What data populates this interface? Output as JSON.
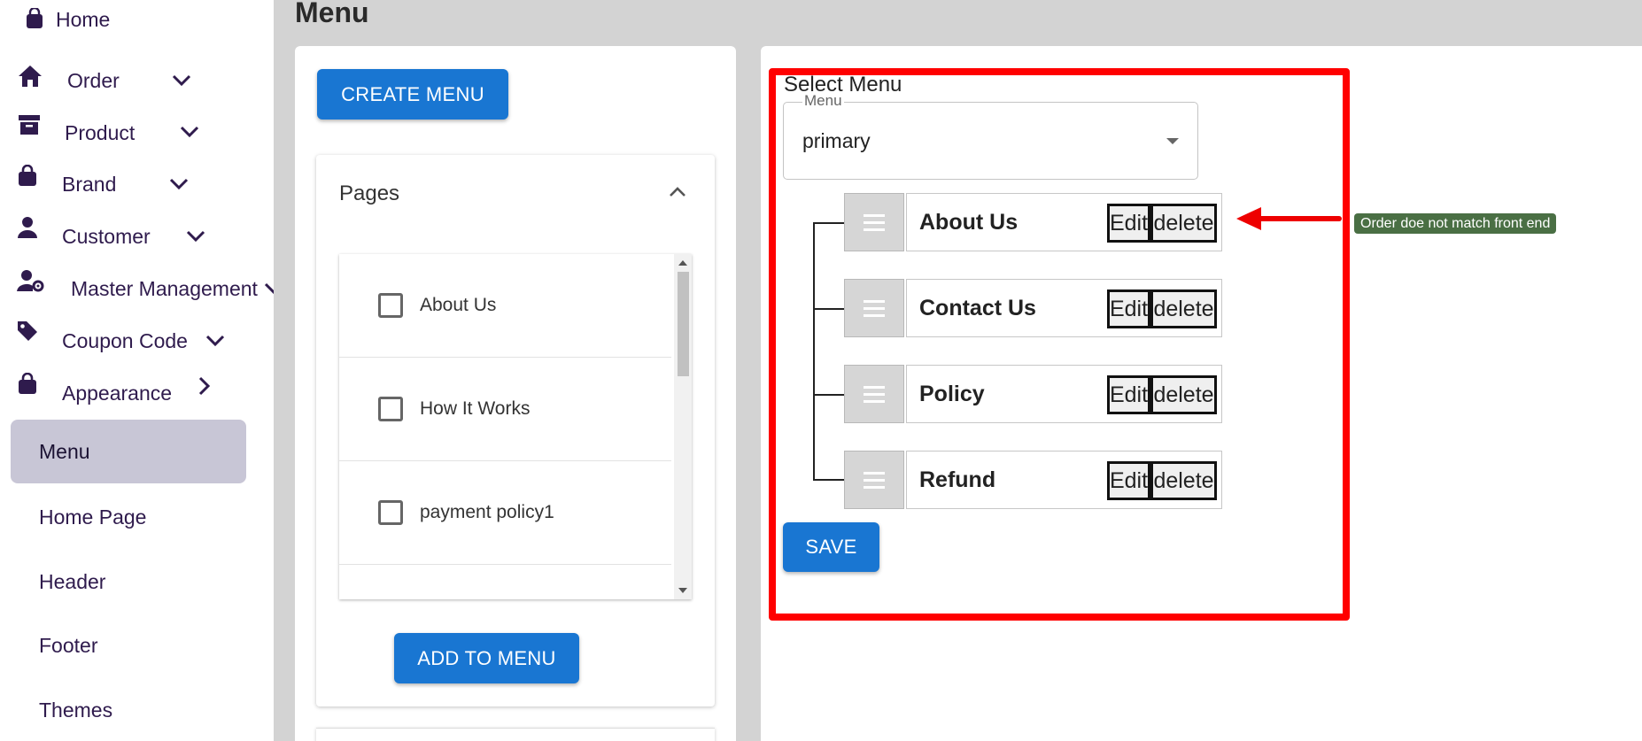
{
  "sidebar": {
    "home": {
      "label": "Home",
      "icon": "shopping-bag-icon"
    },
    "items": [
      {
        "label": "Order",
        "icon": "home-icon",
        "chevron": "chevron-down-icon"
      },
      {
        "label": "Product",
        "icon": "archive-icon",
        "chevron": "chevron-down-icon"
      },
      {
        "label": "Brand",
        "icon": "shopping-bag-icon",
        "chevron": "chevron-down-icon"
      },
      {
        "label": "Customer",
        "icon": "person-icon",
        "chevron": "chevron-down-icon"
      },
      {
        "label": "Master Management",
        "icon": "user-gear-icon",
        "chevron": "chevron-down-icon"
      },
      {
        "label": "Coupon Code",
        "icon": "tag-icon",
        "chevron": "chevron-down-icon"
      },
      {
        "label": "Appearance",
        "icon": "shopping-bag-icon",
        "chevron": "chevron-right-icon"
      }
    ],
    "subitems": [
      {
        "label": "Menu",
        "active": true
      },
      {
        "label": "Home Page"
      },
      {
        "label": "Header"
      },
      {
        "label": "Footer"
      },
      {
        "label": "Themes"
      }
    ]
  },
  "main": {
    "title": "Menu",
    "create_button": "CREATE MENU",
    "pages_panel": {
      "title": "Pages",
      "items": [
        "About Us",
        "How It Works",
        "payment policy1"
      ],
      "add_button": "ADD TO MENU"
    },
    "menu_editor": {
      "select_title": "Select Menu",
      "select_legend": "Menu",
      "selected_value": "primary",
      "items": [
        {
          "name": "About Us",
          "edit": "Edit",
          "delete": "delete"
        },
        {
          "name": "Contact Us",
          "edit": "Edit",
          "delete": "delete"
        },
        {
          "name": "Policy",
          "edit": "Edit",
          "delete": "delete"
        },
        {
          "name": "Refund",
          "edit": "Edit",
          "delete": "delete"
        }
      ],
      "save_button": "SAVE"
    },
    "annotation": {
      "note": "Order doe not match front end",
      "highlight_color": "#ff0000",
      "note_color": "#4a6f44"
    }
  },
  "colors": {
    "primary_button": "#1976d2",
    "sidebar_text": "#2f1b4d",
    "active_menu_bg": "#c8c6d6",
    "content_bg": "#d3d3d3"
  }
}
